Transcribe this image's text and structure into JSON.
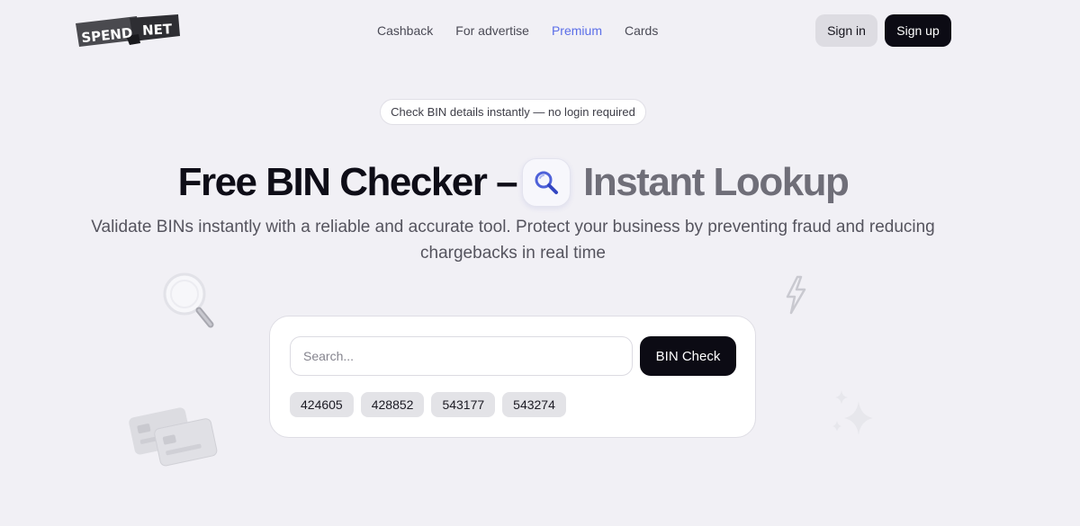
{
  "header": {
    "logo": {
      "part1": "SPEND",
      "part2": "NET"
    },
    "nav": [
      {
        "label": "Cashback",
        "active": false
      },
      {
        "label": "For advertise",
        "active": false
      },
      {
        "label": "Premium",
        "active": true
      },
      {
        "label": "Cards",
        "active": false
      }
    ],
    "signin_label": "Sign in",
    "signup_label": "Sign up"
  },
  "hero": {
    "pill_text": "Check BIN details instantly — no login required",
    "title_dark": "Free BIN Checker –",
    "title_grey": "Instant Lookup",
    "subtitle": "Validate BINs instantly with a reliable and accurate tool. Protect your business by preventing fraud and reducing chargebacks in real time"
  },
  "search": {
    "placeholder": "Search...",
    "value": "",
    "button_label": "BIN Check",
    "examples": [
      "424605",
      "428852",
      "543177",
      "543274"
    ]
  },
  "colors": {
    "background": "#f1f0f5",
    "accent": "#5b6ee8",
    "primary_button": "#0c0b14"
  },
  "icons": [
    "magnifier-icon",
    "lightning-icon",
    "sparkles-icon",
    "credit-cards-icon",
    "search-icon"
  ]
}
